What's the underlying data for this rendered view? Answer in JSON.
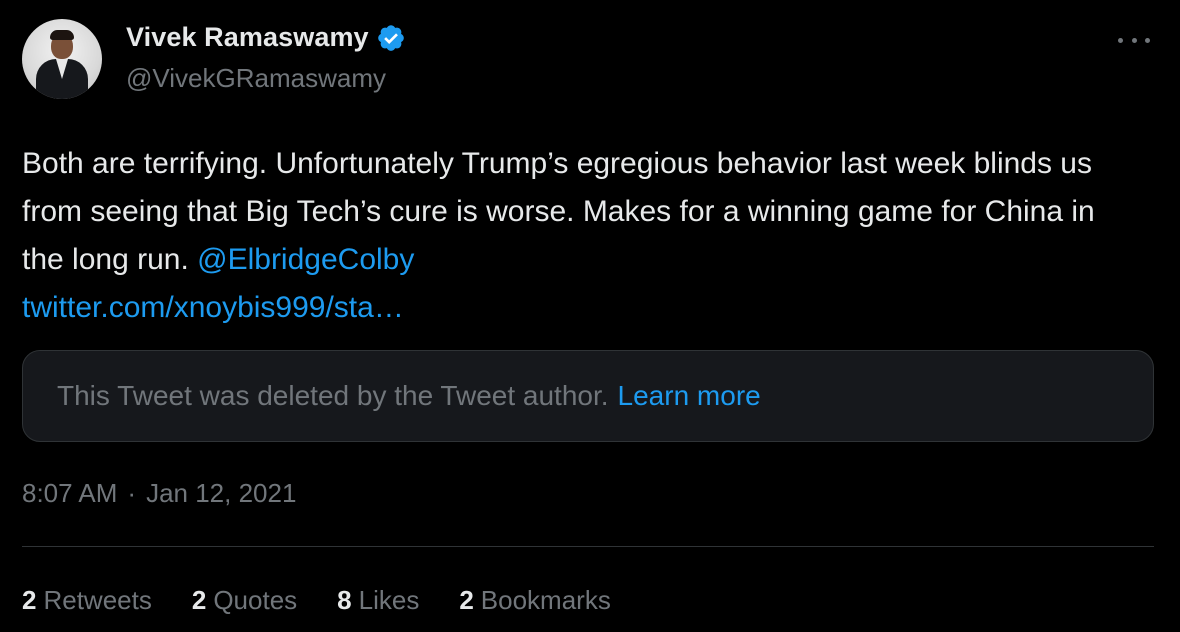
{
  "author": {
    "name": "Vivek Ramaswamy",
    "handle": "@VivekGRamaswamy",
    "verified_icon": "verified-badge-icon",
    "avatar_icon": "profile-photo"
  },
  "tweet": {
    "text": "Both are terrifying. Unfortunately Trump’s egregious behavior last week blinds us from seeing that Big Tech’s cure is worse. Makes for a winning game for China in the long run. ",
    "mention": "@ElbridgeColby",
    "url": "twitter.com/xnoybis999/sta…"
  },
  "quoted_tweet": {
    "message": "This Tweet was deleted by the Tweet author.",
    "learn_more": "Learn more"
  },
  "timestamp": {
    "time": "8:07 AM",
    "separator": "·",
    "date": "Jan 12, 2021"
  },
  "stats": {
    "retweets": {
      "count": "2",
      "label": "Retweets"
    },
    "quotes": {
      "count": "2",
      "label": "Quotes"
    },
    "likes": {
      "count": "8",
      "label": "Likes"
    },
    "bookmarks": {
      "count": "2",
      "label": "Bookmarks"
    }
  },
  "colors": {
    "background": "#000000",
    "text": "#e7e9ea",
    "secondary": "#71767b",
    "accent": "#1d9bf0",
    "border": "#2f3336"
  }
}
